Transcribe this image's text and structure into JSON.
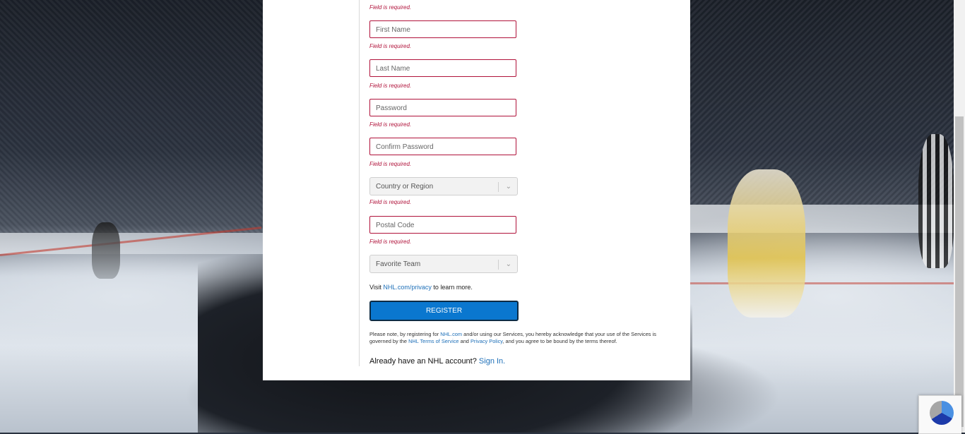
{
  "form": {
    "top_error": "Field is required.",
    "first_name": {
      "placeholder": "First Name",
      "error": "Field is required."
    },
    "last_name": {
      "placeholder": "Last Name",
      "error": "Field is required."
    },
    "password": {
      "placeholder": "Password",
      "error": "Field is required."
    },
    "confirm_password": {
      "placeholder": "Confirm Password",
      "error": "Field is required."
    },
    "country": {
      "placeholder": "Country or Region",
      "error": "Field is required."
    },
    "postal_code": {
      "placeholder": "Postal Code",
      "error": "Field is required."
    },
    "favorite_team": {
      "placeholder": "Favorite Team"
    },
    "privacy": {
      "prefix": "Visit ",
      "link": "NHL.com/privacy",
      "suffix": " to learn more."
    },
    "register_label": "REGISTER",
    "legal": {
      "t1": "Please note, by registering for ",
      "l1": "NHL.com",
      "t2": " and/or using our Services, you hereby acknowledge that your use of the Services is governed by the ",
      "l2": "NHL Terms of Service",
      "t3": " and ",
      "l3": "Privacy Policy",
      "t4": ", and you agree to be bound by the terms thereof."
    },
    "signin": {
      "prefix": "Already have an NHL account? ",
      "link": "Sign In."
    }
  },
  "icons": {
    "chevron": "chevron-down-icon",
    "recaptcha": "recaptcha-icon"
  },
  "colors": {
    "error": "#b0123a",
    "register_bg": "#0a77cf",
    "link": "#1d6fb8"
  }
}
